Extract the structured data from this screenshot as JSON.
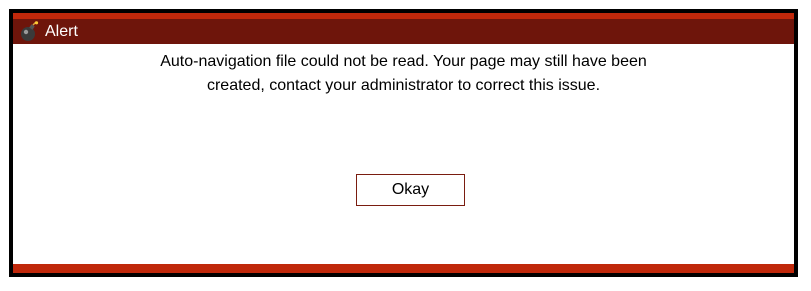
{
  "dialog": {
    "title": "Alert",
    "icon": "bomb-icon",
    "message_line1": "Auto-navigation file could not be read. Your page may still have been",
    "message_line2": "created, contact your administrator to correct this issue.",
    "okay_label": "Okay"
  },
  "colors": {
    "title_bar": "#6e150b",
    "accent_strip": "#c0280b",
    "frame": "#000000",
    "button_border": "#7a1d10"
  }
}
